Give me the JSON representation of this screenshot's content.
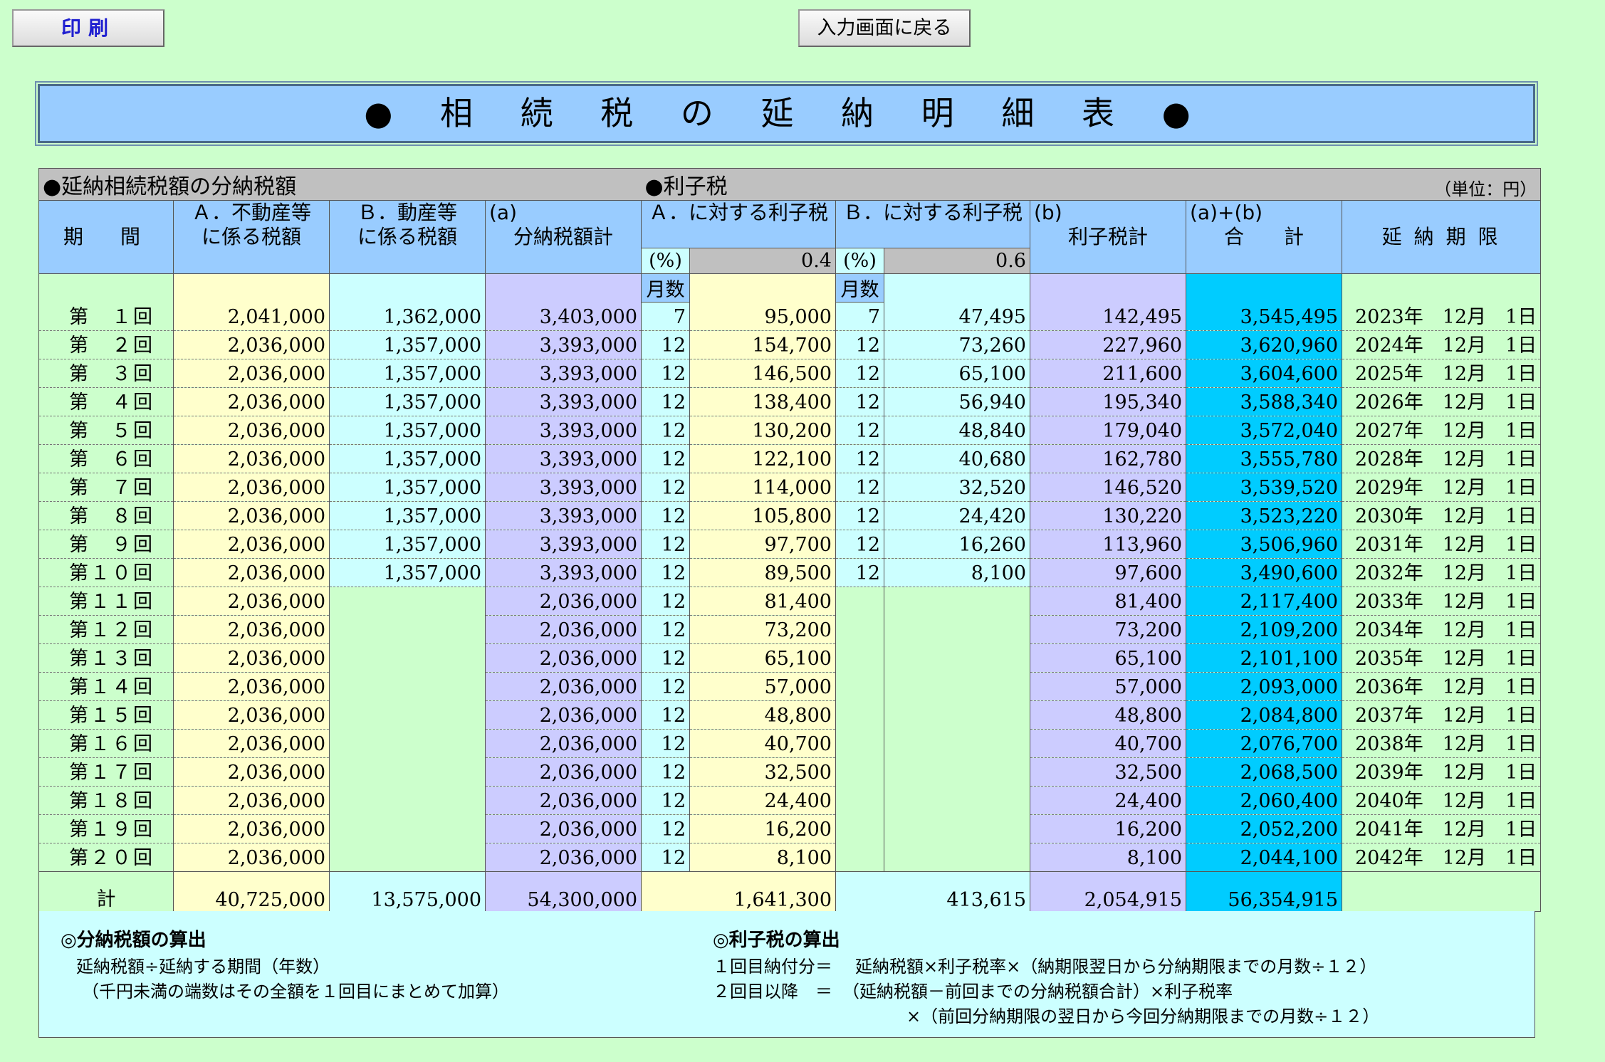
{
  "toolbar": {
    "print_label": "印刷",
    "back_label": "入力画面に戻る"
  },
  "title": "● 相 続 税 の 延 納 明 細 表 ●",
  "sections": {
    "left": "●延納相続税額の分納税額",
    "right": "●利子税",
    "unit": "（単位：円）"
  },
  "headers": {
    "period": "期　間",
    "a_line1": "Ａ．不動産等",
    "a_line2": "に係る税額",
    "b_line1": "Ｂ．動産等",
    "b_line2": "に係る税額",
    "sum_a_line1": "(a)",
    "sum_a_line2": "分納税額計",
    "int_a": "Ａ．に対する利子税",
    "int_b": "Ｂ．に対する利子税",
    "pct": "(%)",
    "rate_a": "0.4",
    "rate_b": "0.6",
    "months": "月数",
    "sum_b_line1": "(b)",
    "sum_b_line2": "利子税計",
    "total_line1": "(a)+(b)",
    "total_line2": "合　　計",
    "deadline": "延 納 期 限"
  },
  "rows": [
    {
      "period": "第　１回",
      "a": "2,041,000",
      "b": "1,362,000",
      "sa": "3,403,000",
      "ma": "7",
      "ia": "95,000",
      "mb": "7",
      "ib": "47,495",
      "sb": "142,495",
      "total": "3,545,495",
      "deadline": "2023年　12月　1日"
    },
    {
      "period": "第　２回",
      "a": "2,036,000",
      "b": "1,357,000",
      "sa": "3,393,000",
      "ma": "12",
      "ia": "154,700",
      "mb": "12",
      "ib": "73,260",
      "sb": "227,960",
      "total": "3,620,960",
      "deadline": "2024年　12月　1日"
    },
    {
      "period": "第　３回",
      "a": "2,036,000",
      "b": "1,357,000",
      "sa": "3,393,000",
      "ma": "12",
      "ia": "146,500",
      "mb": "12",
      "ib": "65,100",
      "sb": "211,600",
      "total": "3,604,600",
      "deadline": "2025年　12月　1日"
    },
    {
      "period": "第　４回",
      "a": "2,036,000",
      "b": "1,357,000",
      "sa": "3,393,000",
      "ma": "12",
      "ia": "138,400",
      "mb": "12",
      "ib": "56,940",
      "sb": "195,340",
      "total": "3,588,340",
      "deadline": "2026年　12月　1日"
    },
    {
      "period": "第　５回",
      "a": "2,036,000",
      "b": "1,357,000",
      "sa": "3,393,000",
      "ma": "12",
      "ia": "130,200",
      "mb": "12",
      "ib": "48,840",
      "sb": "179,040",
      "total": "3,572,040",
      "deadline": "2027年　12月　1日"
    },
    {
      "period": "第　６回",
      "a": "2,036,000",
      "b": "1,357,000",
      "sa": "3,393,000",
      "ma": "12",
      "ia": "122,100",
      "mb": "12",
      "ib": "40,680",
      "sb": "162,780",
      "total": "3,555,780",
      "deadline": "2028年　12月　1日"
    },
    {
      "period": "第　７回",
      "a": "2,036,000",
      "b": "1,357,000",
      "sa": "3,393,000",
      "ma": "12",
      "ia": "114,000",
      "mb": "12",
      "ib": "32,520",
      "sb": "146,520",
      "total": "3,539,520",
      "deadline": "2029年　12月　1日"
    },
    {
      "period": "第　８回",
      "a": "2,036,000",
      "b": "1,357,000",
      "sa": "3,393,000",
      "ma": "12",
      "ia": "105,800",
      "mb": "12",
      "ib": "24,420",
      "sb": "130,220",
      "total": "3,523,220",
      "deadline": "2030年　12月　1日"
    },
    {
      "period": "第　９回",
      "a": "2,036,000",
      "b": "1,357,000",
      "sa": "3,393,000",
      "ma": "12",
      "ia": "97,700",
      "mb": "12",
      "ib": "16,260",
      "sb": "113,960",
      "total": "3,506,960",
      "deadline": "2031年　12月　1日"
    },
    {
      "period": "第１０回",
      "a": "2,036,000",
      "b": "1,357,000",
      "sa": "3,393,000",
      "ma": "12",
      "ia": "89,500",
      "mb": "12",
      "ib": "8,100",
      "sb": "97,600",
      "total": "3,490,600",
      "deadline": "2032年　12月　1日"
    },
    {
      "period": "第１１回",
      "a": "2,036,000",
      "b": "",
      "sa": "2,036,000",
      "ma": "12",
      "ia": "81,400",
      "mb": "",
      "ib": "",
      "sb": "81,400",
      "total": "2,117,400",
      "deadline": "2033年　12月　1日"
    },
    {
      "period": "第１２回",
      "a": "2,036,000",
      "b": "",
      "sa": "2,036,000",
      "ma": "12",
      "ia": "73,200",
      "mb": "",
      "ib": "",
      "sb": "73,200",
      "total": "2,109,200",
      "deadline": "2034年　12月　1日"
    },
    {
      "period": "第１３回",
      "a": "2,036,000",
      "b": "",
      "sa": "2,036,000",
      "ma": "12",
      "ia": "65,100",
      "mb": "",
      "ib": "",
      "sb": "65,100",
      "total": "2,101,100",
      "deadline": "2035年　12月　1日"
    },
    {
      "period": "第１４回",
      "a": "2,036,000",
      "b": "",
      "sa": "2,036,000",
      "ma": "12",
      "ia": "57,000",
      "mb": "",
      "ib": "",
      "sb": "57,000",
      "total": "2,093,000",
      "deadline": "2036年　12月　1日"
    },
    {
      "period": "第１５回",
      "a": "2,036,000",
      "b": "",
      "sa": "2,036,000",
      "ma": "12",
      "ia": "48,800",
      "mb": "",
      "ib": "",
      "sb": "48,800",
      "total": "2,084,800",
      "deadline": "2037年　12月　1日"
    },
    {
      "period": "第１６回",
      "a": "2,036,000",
      "b": "",
      "sa": "2,036,000",
      "ma": "12",
      "ia": "40,700",
      "mb": "",
      "ib": "",
      "sb": "40,700",
      "total": "2,076,700",
      "deadline": "2038年　12月　1日"
    },
    {
      "period": "第１７回",
      "a": "2,036,000",
      "b": "",
      "sa": "2,036,000",
      "ma": "12",
      "ia": "32,500",
      "mb": "",
      "ib": "",
      "sb": "32,500",
      "total": "2,068,500",
      "deadline": "2039年　12月　1日"
    },
    {
      "period": "第１８回",
      "a": "2,036,000",
      "b": "",
      "sa": "2,036,000",
      "ma": "12",
      "ia": "24,400",
      "mb": "",
      "ib": "",
      "sb": "24,400",
      "total": "2,060,400",
      "deadline": "2040年　12月　1日"
    },
    {
      "period": "第１９回",
      "a": "2,036,000",
      "b": "",
      "sa": "2,036,000",
      "ma": "12",
      "ia": "16,200",
      "mb": "",
      "ib": "",
      "sb": "16,200",
      "total": "2,052,200",
      "deadline": "2041年　12月　1日"
    },
    {
      "period": "第２０回",
      "a": "2,036,000",
      "b": "",
      "sa": "2,036,000",
      "ma": "12",
      "ia": "8,100",
      "mb": "",
      "ib": "",
      "sb": "8,100",
      "total": "2,044,100",
      "deadline": "2042年　12月　1日"
    }
  ],
  "totals": {
    "label": "計",
    "a": "40,725,000",
    "b": "13,575,000",
    "sa": "54,300,000",
    "ia": "1,641,300",
    "ib": "413,615",
    "sb": "2,054,915",
    "total": "56,354,915"
  },
  "notes": {
    "left_title": "◎分納税額の算出",
    "left_1": "延納税額÷延納する期間（年数）",
    "left_2": "（千円未満の端数はその全額を１回目にまとめて加算）",
    "right_title": "◎利子税の算出",
    "right_1a": "１回目納付分＝",
    "right_1b": "延納税額×利子税率×（納期限翌日から分納期限までの月数÷１２）",
    "right_2a": "２回目以降　＝",
    "right_2b": "（延納税額－前回までの分納税額合計）×利子税率",
    "right_3": "×（前回分納期限の翌日から今回分納期限までの月数÷１２）"
  }
}
